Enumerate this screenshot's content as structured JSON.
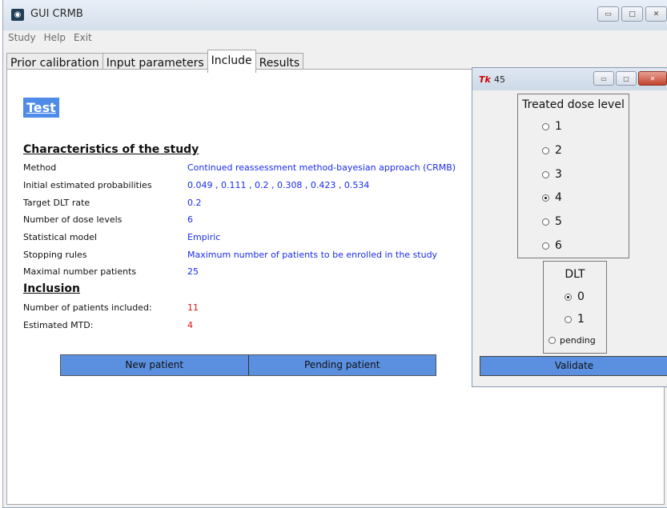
{
  "app": {
    "title": "GUI CRMB",
    "icon": "app-logo-icon"
  },
  "window_buttons": {
    "minimize": "▭",
    "maximize": "□",
    "close": "✕"
  },
  "menu": [
    "Study",
    "Help",
    "Exit"
  ],
  "tabs": [
    {
      "label": "Prior calibration",
      "active": false
    },
    {
      "label": "Input parameters",
      "active": false
    },
    {
      "label": "Include",
      "active": true
    },
    {
      "label": "Results",
      "active": false
    }
  ],
  "main": {
    "test_title": "Test",
    "characteristics_heading": "Characteristics of the study",
    "characteristics": [
      {
        "label": "Method",
        "value": "Continued reassessment method-bayesian approach (CRMB)"
      },
      {
        "label": "Initial estimated probabilities",
        "value": "0.049 , 0.111 , 0.2 , 0.308 , 0.423 , 0.534"
      },
      {
        "label": "Target DLT rate",
        "value": "0.2"
      },
      {
        "label": "Number of dose levels",
        "value": "6"
      },
      {
        "label": "Statistical model",
        "value": "Empiric"
      },
      {
        "label": "Stopping rules",
        "value": "Maximum number of patients to be enrolled in the study"
      },
      {
        "label": "Maximal number patients",
        "value": "25"
      }
    ],
    "inclusion_heading": "Inclusion",
    "inclusion": [
      {
        "label": "Number of patients included:",
        "value": "11"
      },
      {
        "label": "Estimated MTD:",
        "value": "4"
      }
    ],
    "buttons": {
      "new_patient": "New patient",
      "pending_patient": "Pending patient"
    }
  },
  "dialog": {
    "title": "45",
    "tk_icon": "Tk",
    "dose_heading": "Treated dose level",
    "dose_levels": [
      "1",
      "2",
      "3",
      "4",
      "5",
      "6"
    ],
    "dose_selected": "4",
    "dlt_heading": "DLT",
    "dlt_options": [
      "0",
      "1",
      "pending"
    ],
    "dlt_selected": "0",
    "validate_label": "Validate"
  },
  "colors": {
    "accent_blue": "#5b8fe0",
    "value_blue": "#1a2bf0",
    "value_red": "#e11010"
  }
}
